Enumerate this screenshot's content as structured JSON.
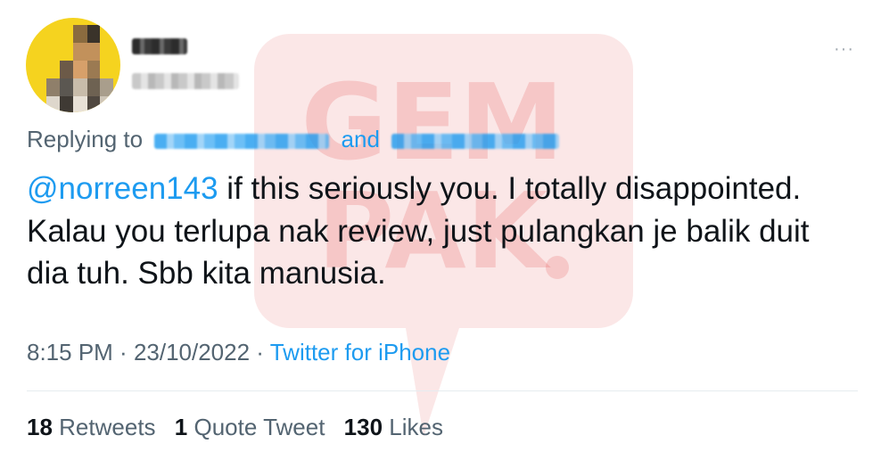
{
  "watermark": {
    "text_line1": "GEM",
    "text_line2": "PAK"
  },
  "menu": {
    "icon": "more-icon",
    "label": "···"
  },
  "reply": {
    "prefix": "Replying to",
    "conjunction": "and"
  },
  "tweet": {
    "mention": "@norreen143",
    "body": " if this seriously you. I totally disappointed. Kalau you terlupa nak review, just pulangkan je balik duit dia tuh. Sbb kita manusia."
  },
  "meta": {
    "time": "8:15 PM",
    "separator1": " · ",
    "date": "23/10/2022",
    "separator2": " · ",
    "source": "Twitter for iPhone"
  },
  "stats": {
    "retweets_count": "18",
    "retweets_label": "Retweets",
    "quotes_count": "1",
    "quotes_label": "Quote Tweet",
    "likes_count": "130",
    "likes_label": "Likes"
  },
  "colors": {
    "accent": "#1d9bf0",
    "text": "#0f1419",
    "secondary": "#536471",
    "watermark": "#e23b3b"
  }
}
